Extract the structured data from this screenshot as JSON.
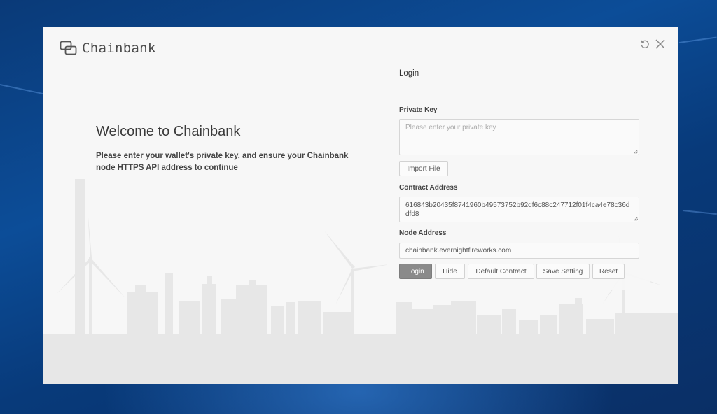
{
  "app": {
    "name": "Chainbank",
    "icon": "chain-link-logo-icon"
  },
  "window_controls": {
    "refresh_icon": "refresh-icon",
    "close_icon": "close-icon"
  },
  "welcome": {
    "title": "Welcome to Chainbank",
    "text": "Please enter your wallet's private key, and ensure your Chainbank node HTTPS API address to continue"
  },
  "login": {
    "header": "Login",
    "private_key": {
      "label": "Private Key",
      "placeholder": "Please enter your private key",
      "value": ""
    },
    "import_label": "Import File",
    "contract": {
      "label": "Contract Address",
      "value": "616843b20435f8741960b49573752b92df6c88c247712f01f4ca4e78c36ddfd8"
    },
    "node": {
      "label": "Node Address",
      "value": "chainbank.evernightfireworks.com"
    },
    "buttons": {
      "login": "Login",
      "hide": "Hide",
      "default_contract": "Default Contract",
      "save_setting": "Save Setting",
      "reset": "Reset"
    }
  },
  "colors": {
    "primary_button": "#8a8a8a",
    "window_bg": "#f7f7f7",
    "skyline": "#e6e6e6",
    "desktop": "#0c4d98"
  }
}
